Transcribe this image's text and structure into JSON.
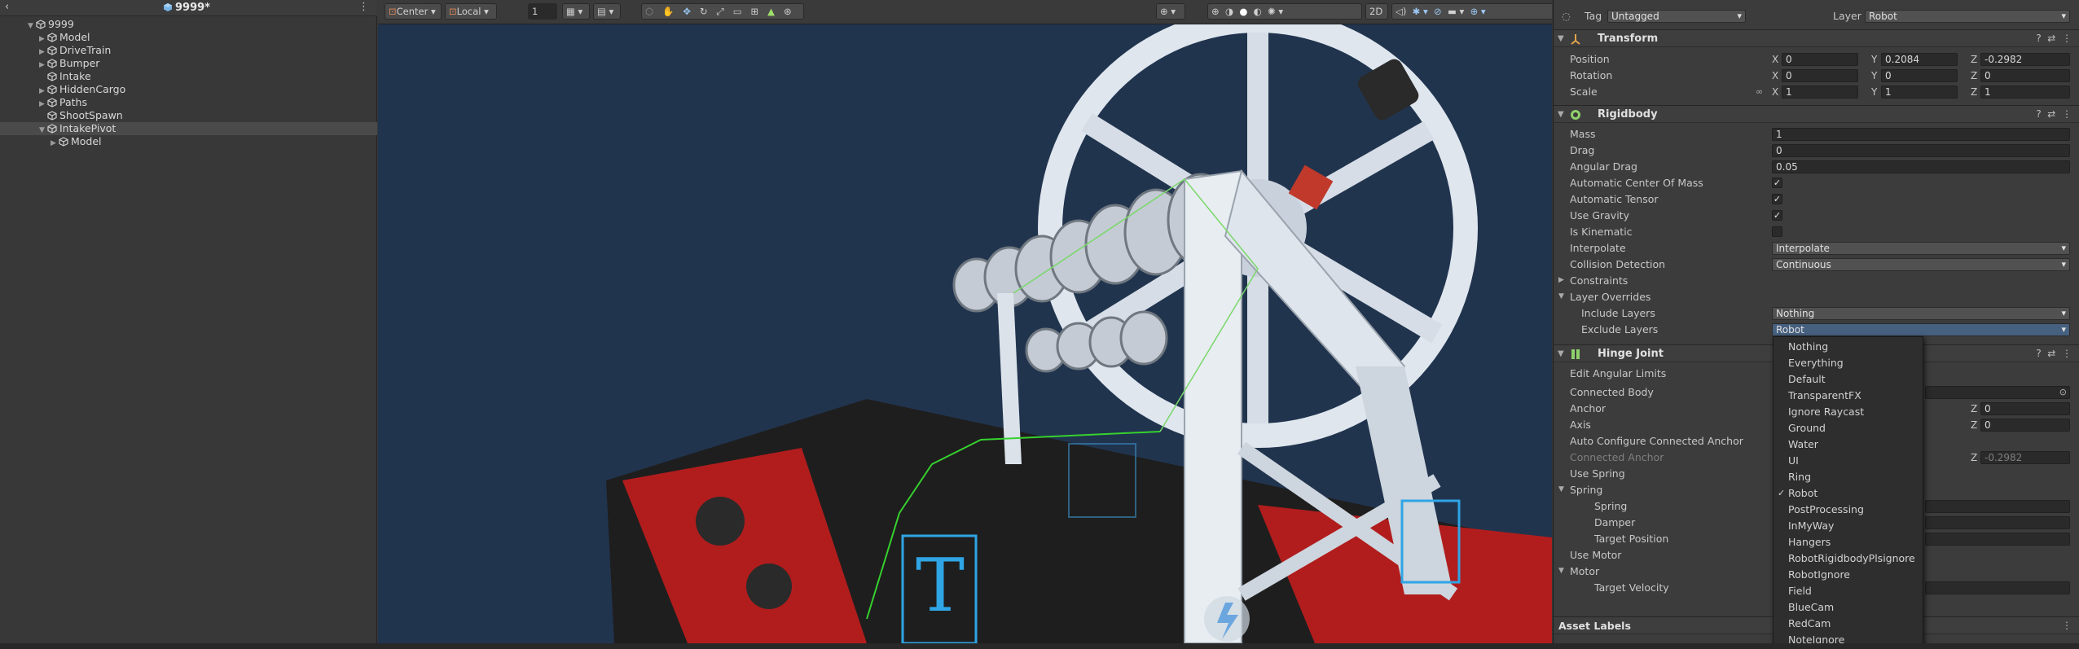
{
  "hierarchy": {
    "back_icon": "chevron-left",
    "scene_name": "9999*",
    "menu_icon": "⋮",
    "items": [
      {
        "label": "9999",
        "depth": 0,
        "arrow": "▼"
      },
      {
        "label": "Model",
        "depth": 1,
        "arrow": "▶"
      },
      {
        "label": "DriveTrain",
        "depth": 1,
        "arrow": "▶"
      },
      {
        "label": "Bumper",
        "depth": 1,
        "arrow": "▶"
      },
      {
        "label": "Intake",
        "depth": 1,
        "arrow": ""
      },
      {
        "label": "HiddenCargo",
        "depth": 1,
        "arrow": "▶"
      },
      {
        "label": "Paths",
        "depth": 1,
        "arrow": "▶"
      },
      {
        "label": "ShootSpawn",
        "depth": 1,
        "arrow": ""
      },
      {
        "label": "IntakePivot",
        "depth": 1,
        "arrow": "▼",
        "selected": true
      },
      {
        "label": "Model",
        "depth": 2,
        "arrow": "▶"
      }
    ]
  },
  "toolbar": {
    "pivot_mode": "Center",
    "pivot_rotation": "Local",
    "grid_value": "1",
    "mode_2d": "2D"
  },
  "inspector": {
    "tag_label": "Tag",
    "tag_value": "Untagged",
    "layer_label": "Layer",
    "layer_value": "Robot",
    "transform": {
      "title": "Transform",
      "position_label": "Position",
      "rotation_label": "Rotation",
      "scale_label": "Scale",
      "position": {
        "x": "0",
        "y": "0.2084",
        "z": "-0.2982"
      },
      "rotation": {
        "x": "0",
        "y": "0",
        "z": "0"
      },
      "scale": {
        "x": "1",
        "y": "1",
        "z": "1"
      }
    },
    "rigidbody": {
      "title": "Rigidbody",
      "mass_label": "Mass",
      "mass": "1",
      "drag_label": "Drag",
      "drag": "0",
      "angular_drag_label": "Angular Drag",
      "angular_drag": "0.05",
      "auto_com_label": "Automatic Center Of Mass",
      "auto_tensor_label": "Automatic Tensor",
      "use_gravity_label": "Use Gravity",
      "is_kinematic_label": "Is Kinematic",
      "interpolate_label": "Interpolate",
      "interpolate": "Interpolate",
      "collision_label": "Collision Detection",
      "collision": "Continuous",
      "constraints_label": "Constraints",
      "layer_overrides_label": "Layer Overrides",
      "include_layers_label": "Include Layers",
      "include_layers": "Nothing",
      "exclude_layers_label": "Exclude Layers",
      "exclude_layers": "Robot"
    },
    "hinge": {
      "title": "Hinge Joint",
      "edit_limits_label": "Edit Angular Limits",
      "connected_body_label": "Connected Body",
      "anchor_label": "Anchor",
      "anchor_z": "0",
      "axis_label": "Axis",
      "axis_z": "0",
      "auto_config_label": "Auto Configure Connected Anchor",
      "connected_anchor_label": "Connected Anchor",
      "connected_anchor_z": "-0.2982",
      "use_spring_label": "Use Spring",
      "spring_group_label": "Spring",
      "spring_label": "Spring",
      "damper_label": "Damper",
      "target_position_label": "Target Position",
      "use_motor_label": "Use Motor",
      "motor_group_label": "Motor",
      "target_velocity_label": "Target Velocity"
    },
    "asset_labels": "Asset Labels",
    "axis_x": "X",
    "axis_y": "Y",
    "axis_z": "Z"
  },
  "layer_popup": {
    "items": [
      "Nothing",
      "Everything",
      "Default",
      "TransparentFX",
      "Ignore Raycast",
      "Ground",
      "Water",
      "UI",
      "Ring",
      "Robot",
      "PostProcessing",
      "InMyWay",
      "Hangers",
      "RobotRigidbodyPlsignore",
      "RobotIgnore",
      "Field",
      "BlueCam",
      "RedCam",
      "NoteIgnore"
    ],
    "checked": "Robot",
    "check_glyph": "✓"
  },
  "colors": {
    "scene_bg": "#21344e",
    "accent": "#46607f",
    "robot_red": "#b11d1d"
  }
}
